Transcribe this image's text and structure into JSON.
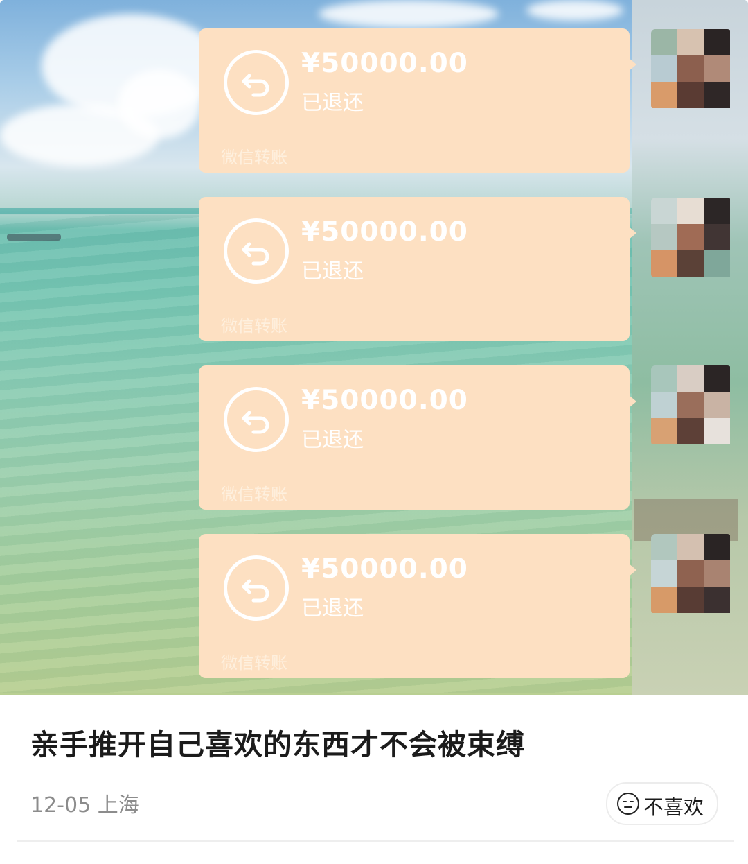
{
  "transfers": [
    {
      "amount": "¥50000.00",
      "status": "已退还",
      "brand": "微信转账"
    },
    {
      "amount": "¥50000.00",
      "status": "已退还",
      "brand": "微信转账"
    },
    {
      "amount": "¥50000.00",
      "status": "已退还",
      "brand": "微信转账"
    },
    {
      "amount": "¥50000.00",
      "status": "已退还",
      "brand": "微信转账"
    }
  ],
  "icons": {
    "refund": "refund-arrow-icon",
    "dislike": "neutral-face-icon"
  },
  "post": {
    "title": "亲手推开自己喜欢的东西才不会被束缚",
    "meta": "12-05 上海",
    "dislike_label": "不喜欢"
  },
  "colors": {
    "card_bg": "#fde0c2",
    "text_white": "#ffffff"
  }
}
